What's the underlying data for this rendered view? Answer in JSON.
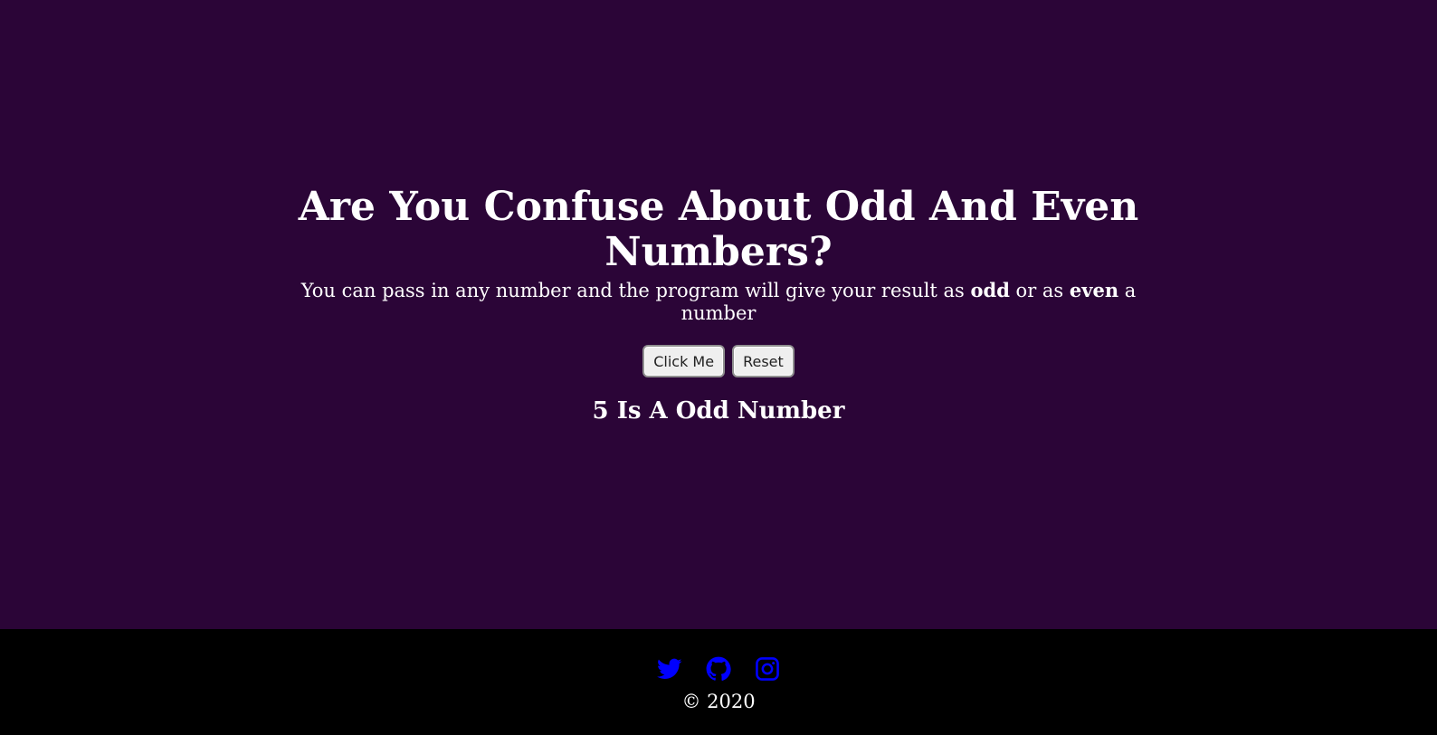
{
  "header": {
    "title": "Are You Confuse About Odd And Even Numbers?"
  },
  "description": {
    "part1": "You can pass in any number and the program will give your result as ",
    "odd": "odd",
    "part2": " or as ",
    "even": "even",
    "part3": " a number"
  },
  "buttons": {
    "click_label": "Click Me",
    "reset_label": "Reset"
  },
  "result": {
    "text": "5 Is A Odd Number"
  },
  "footer": {
    "icons": [
      "twitter-icon",
      "github-icon",
      "instagram-icon"
    ],
    "icon_color": "#0000ff",
    "copyright": "© 2020"
  },
  "colors": {
    "background": "#2b0537",
    "footer_background": "#000000",
    "text": "#ffffff"
  }
}
